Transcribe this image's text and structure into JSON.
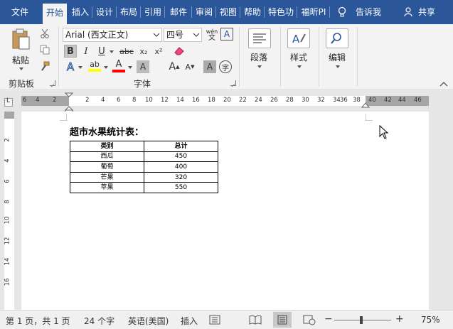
{
  "tabs": [
    "文件",
    "开始",
    "插入",
    "设计",
    "布局",
    "引用",
    "邮件",
    "审阅",
    "视图",
    "帮助",
    "特色功",
    "福昕PI"
  ],
  "tell_me": "告诉我",
  "share": "共享",
  "clipboard": {
    "paste_label": "粘贴",
    "group_label": "剪贴板"
  },
  "font": {
    "font_name": "Arial (西文正文)",
    "font_size": "四号",
    "phonetic_label": "wén",
    "group_label": "字体",
    "bold": "B",
    "italic": "I",
    "underline": "U",
    "strike": "abc",
    "subscript": "x₂",
    "superscript": "x²",
    "grow": "A",
    "shrink": "A",
    "highlight": "ab",
    "color": "A",
    "effects": "A",
    "char_shade": "A",
    "enclose": "字"
  },
  "paragraph": {
    "label": "段落"
  },
  "styles": {
    "label": "样式"
  },
  "editing": {
    "label": "编辑"
  },
  "ruler": {
    "left_numbers": [
      "6",
      "4",
      "2"
    ],
    "numbers": [
      "2",
      "4",
      "6",
      "8",
      "10",
      "12",
      "14",
      "16",
      "18",
      "20",
      "22",
      "24",
      "26",
      "28",
      "30",
      "32",
      "34",
      "36",
      "38"
    ],
    "right_numbers": [
      "40",
      "42",
      "44",
      "46"
    ]
  },
  "vruler": {
    "numbers": [
      "2",
      "4",
      "6",
      "8",
      "10",
      "12",
      "14",
      "16"
    ]
  },
  "document": {
    "title": "超市水果统计表：",
    "table": {
      "headers": [
        "类别",
        "总计"
      ],
      "rows": [
        [
          "西瓜",
          "450"
        ],
        [
          "葡萄",
          "400"
        ],
        [
          "芒果",
          "320"
        ],
        [
          "苹果",
          "550"
        ]
      ]
    }
  },
  "status": {
    "page": "第 1 页，共 1 页",
    "words": "24 个字",
    "language": "英语(美国)",
    "insert_mode": "插入",
    "zoom": "75%",
    "zoom_minus": "−",
    "zoom_plus": "+"
  },
  "colors": {
    "ribbon_blue": "#2b579a",
    "highlight_yellow": "#ffff00",
    "font_red": "#ff0000"
  }
}
